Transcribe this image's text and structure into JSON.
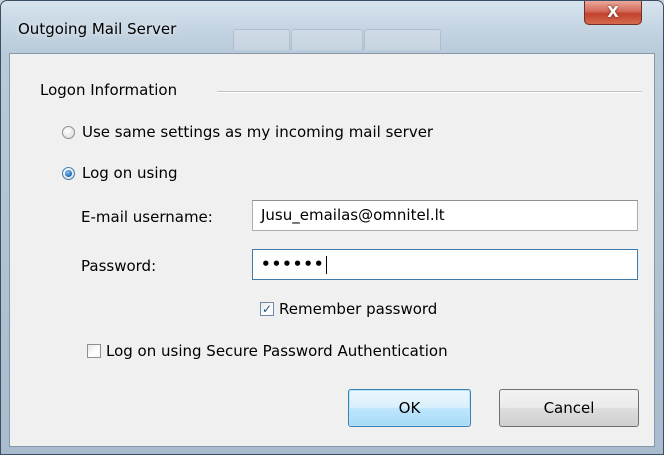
{
  "window": {
    "title": "Outgoing Mail Server",
    "close_label": "X"
  },
  "group": {
    "label": "Logon Information"
  },
  "options": {
    "same_settings": {
      "label": "Use same settings as my incoming mail server",
      "selected": false
    },
    "log_on_using": {
      "label": "Log on using",
      "selected": true
    }
  },
  "fields": {
    "username": {
      "label": "E-mail username:",
      "value": "Jusu_emailas@omnitel.lt"
    },
    "password": {
      "label": "Password:",
      "value": "••••••"
    }
  },
  "checkboxes": {
    "remember_password": {
      "label": "Remember password",
      "checked": true,
      "mark": "✓"
    },
    "spa": {
      "label": "Log on using Secure Password Authentication",
      "checked": false
    }
  },
  "buttons": {
    "ok": "OK",
    "cancel": "Cancel"
  },
  "colors": {
    "accent": "#3c7fb1",
    "close_button": "#c2412e",
    "dialog_background": "#f0f0f0"
  },
  "icons": {
    "close": "close-icon",
    "radio": "radio-button",
    "checkbox": "checkbox"
  }
}
